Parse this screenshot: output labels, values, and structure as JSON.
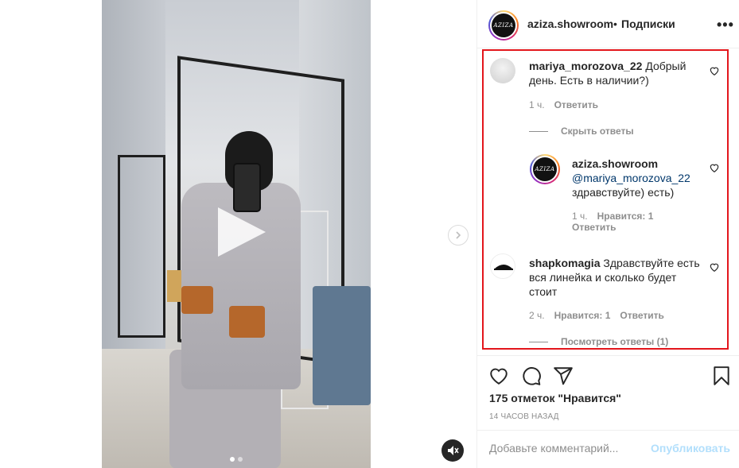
{
  "post": {
    "username": "aziza.showroom",
    "separator": "•",
    "follow_status": "Подписки",
    "avatar_logo_text": "AZIZA",
    "more_icon": "more-horizontal-icon"
  },
  "comments": [
    {
      "username": "mariya_morozova_22",
      "text": "Добрый день. Есть в наличии?)",
      "time": "1 ч.",
      "reply_label": "Ответить",
      "thread_toggle": "Скрыть ответы"
    },
    {
      "username": "aziza.showroom",
      "mention": "@mariya_morozova_22",
      "text": "здравствуйте) есть)",
      "time": "1 ч.",
      "likes_label": "Нравится: 1",
      "reply_label": "Ответить"
    },
    {
      "username": "shapkomagia",
      "text": "Здравствуйте есть вся линейка и сколько будет стоит",
      "time": "2 ч.",
      "likes_label": "Нравится: 1",
      "reply_label": "Ответить",
      "thread_toggle": "Посмотреть ответы (1)"
    }
  ],
  "actions": {
    "likes_text": "175 отметок \"Нравится\"",
    "time_ago": "14 ЧАСОВ НАЗАД",
    "comment_placeholder": "Добавьте комментарий...",
    "publish_label": "Опубликовать"
  },
  "media": {
    "carousel_total": 2,
    "carousel_active": 1,
    "play_icon": "play-icon",
    "muted": true
  },
  "colors": {
    "highlight_border": "#e3161c",
    "link": "#00376b",
    "publish_disabled": "#b2dffc",
    "secondary_text": "#8e8e8e"
  }
}
